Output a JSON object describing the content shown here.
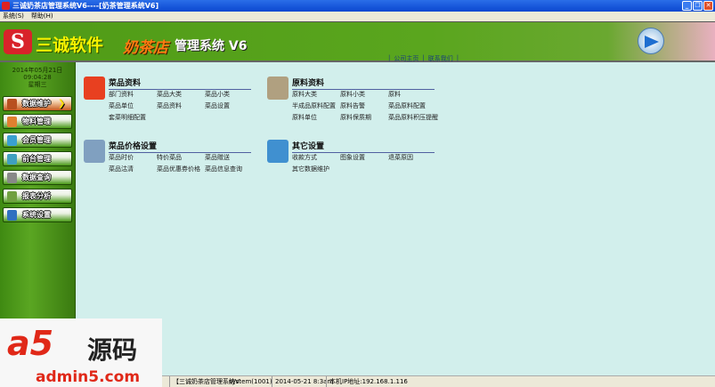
{
  "window": {
    "title": "三诚奶茶店管理系统V6----[奶茶管理系统V6]"
  },
  "menu": [
    "系统(S)",
    "帮助(H)"
  ],
  "banner": {
    "logo": "S",
    "brand": "三诚软件",
    "product": "奶茶店",
    "system": "管理系统 V6",
    "links": [
      "公司主页",
      "联系我们"
    ]
  },
  "sidebar": {
    "date": "2014年05月21日",
    "time": "09:04:28",
    "weekday": "星期三",
    "items": [
      {
        "label": "数据维护",
        "active": true,
        "color": "#b85020"
      },
      {
        "label": "物料管理",
        "color": "#e08030"
      },
      {
        "label": "会员管理",
        "color": "#3aa0d0"
      },
      {
        "label": "前台管理",
        "color": "#40a0c0"
      },
      {
        "label": "数据查询",
        "color": "#888888"
      },
      {
        "label": "报表分析",
        "color": "#70a040"
      },
      {
        "label": "系统设置",
        "color": "#3070c0"
      }
    ]
  },
  "sections": [
    {
      "title": "菜品资料",
      "icon": "books-icon",
      "color": "#e84020",
      "items": [
        "部门资料",
        "菜品大类",
        "菜品小类",
        "菜品单位",
        "菜品资料",
        "菜品设置",
        "套菜明细配置"
      ]
    },
    {
      "title": "原料资料",
      "icon": "folder-icon",
      "color": "#b0a080",
      "items": [
        "原料大类",
        "原料小类",
        "原料",
        "半成品原料配置",
        "原料告警",
        "菜品原料配置",
        "原料单位",
        "原料保质期",
        "菜品原料积压提醒"
      ]
    },
    {
      "title": "菜品价格设置",
      "icon": "chart-icon",
      "color": "#80a0c0",
      "items": [
        "菜品时价",
        "特价菜品",
        "菜品赠送",
        "菜品沽清",
        "菜品优惠券价格",
        "菜品信息查询"
      ]
    },
    {
      "title": "其它设置",
      "icon": "computer-icon",
      "color": "#4090d0",
      "items": [
        "收款方式",
        "图象设置",
        "退菜原因",
        "其它数据维护"
      ]
    }
  ],
  "status": {
    "app": "【三诚奶茶店管理系统V",
    "user": "system(1001)",
    "datetime": "2014-05-21 8:3am",
    "ip": "本机IP地址:192.168.1.116"
  },
  "watermark": {
    "logo": "a5",
    "text": "源码",
    "domain": "admin5.com"
  }
}
